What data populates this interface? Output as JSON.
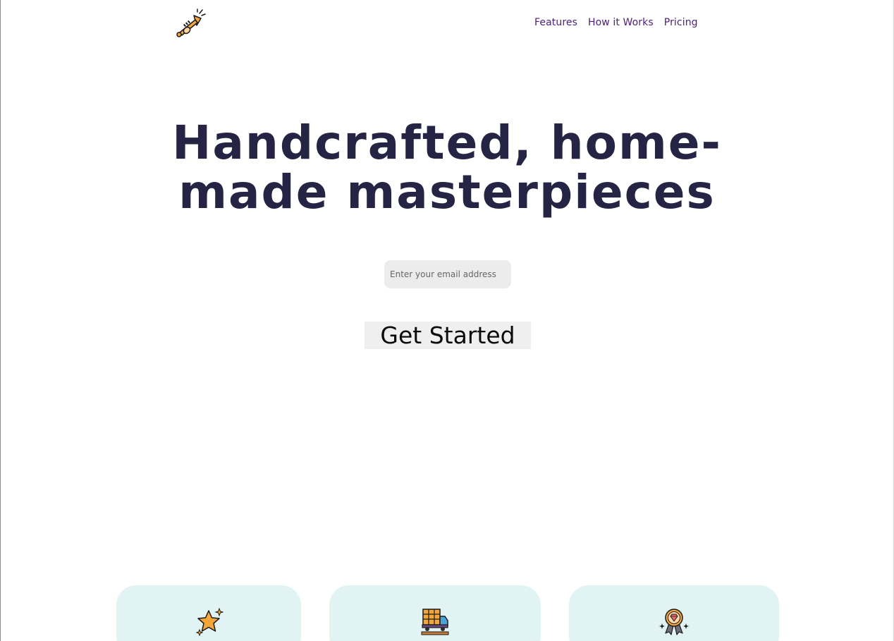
{
  "header": {
    "logo_icon": "trumpet-icon",
    "nav": [
      {
        "label": "Features"
      },
      {
        "label": "How it Works"
      },
      {
        "label": "Pricing"
      }
    ]
  },
  "hero": {
    "title": "Handcrafted, home-made masterpieces",
    "email_placeholder": "Enter your email address",
    "cta_label": "Get Started"
  },
  "features": [
    {
      "icon": "star-icon"
    },
    {
      "icon": "delivery-truck-icon"
    },
    {
      "icon": "diamond-badge-icon"
    }
  ],
  "colors": {
    "title": "#262444",
    "nav_link": "#4b1f7a",
    "input_bg": "#ececec",
    "button_bg": "#efefef",
    "card_bg": "#e1f3f3",
    "accent_orange": "#f4a63a"
  }
}
